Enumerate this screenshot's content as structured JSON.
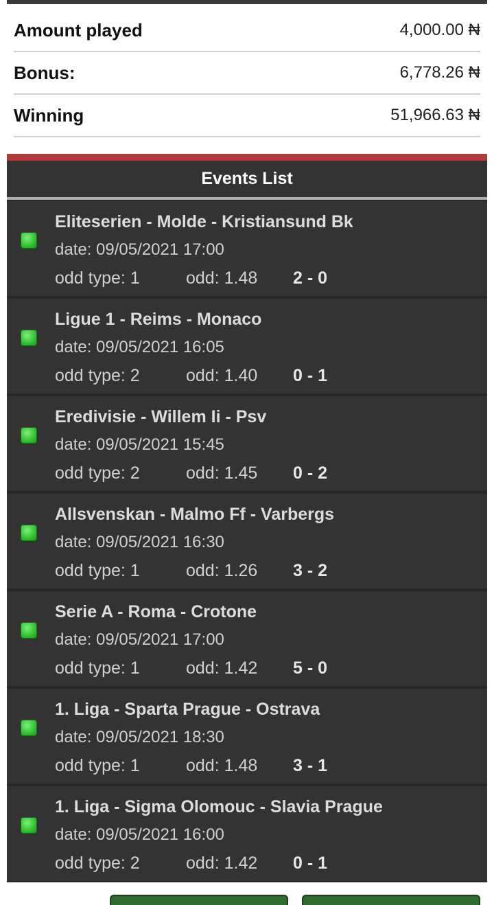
{
  "summary": {
    "amount_played": {
      "label": "Amount played",
      "value": "4,000.00 ₦"
    },
    "bonus": {
      "label": "Bonus:",
      "value": "6,778.26 ₦"
    },
    "winning": {
      "label": "Winning",
      "value": "51,966.63 ₦"
    }
  },
  "events_header": "Events List",
  "events": [
    {
      "title": "Eliteserien - Molde - Kristiansund Bk",
      "date": "date: 09/05/2021 17:00",
      "odd_type": "odd type: 1",
      "odd": "odd: 1.48",
      "score": "2 - 0"
    },
    {
      "title": "Ligue 1 - Reims - Monaco",
      "date": "date: 09/05/2021 16:05",
      "odd_type": "odd type: 2",
      "odd": "odd: 1.40",
      "score": "0 - 1"
    },
    {
      "title": "Eredivisie - Willem Ii - Psv",
      "date": "date: 09/05/2021 15:45",
      "odd_type": "odd type: 2",
      "odd": "odd: 1.45",
      "score": "0 - 2"
    },
    {
      "title": "Allsvenskan - Malmo Ff - Varbergs",
      "date": "date: 09/05/2021 16:30",
      "odd_type": "odd type: 1",
      "odd": "odd: 1.26",
      "score": "3 - 2"
    },
    {
      "title": "Serie A - Roma - Crotone",
      "date": "date: 09/05/2021 17:00",
      "odd_type": "odd type: 1",
      "odd": "odd: 1.42",
      "score": "5 - 0"
    },
    {
      "title": "1. Liga - Sparta Prague - Ostrava",
      "date": "date: 09/05/2021 18:30",
      "odd_type": "odd type: 1",
      "odd": "odd: 1.48",
      "score": "3 - 1"
    },
    {
      "title": "1. Liga - Sigma Olomouc - Slavia Prague",
      "date": "date: 09/05/2021 16:00",
      "odd_type": "odd type: 2",
      "odd": "odd: 1.42",
      "score": "0 - 1"
    }
  ],
  "colors": {
    "status_won": "#33c233",
    "accent_rule": "#b33a3a",
    "header_bg": "#333333",
    "button_green": "#2f6b2f"
  }
}
